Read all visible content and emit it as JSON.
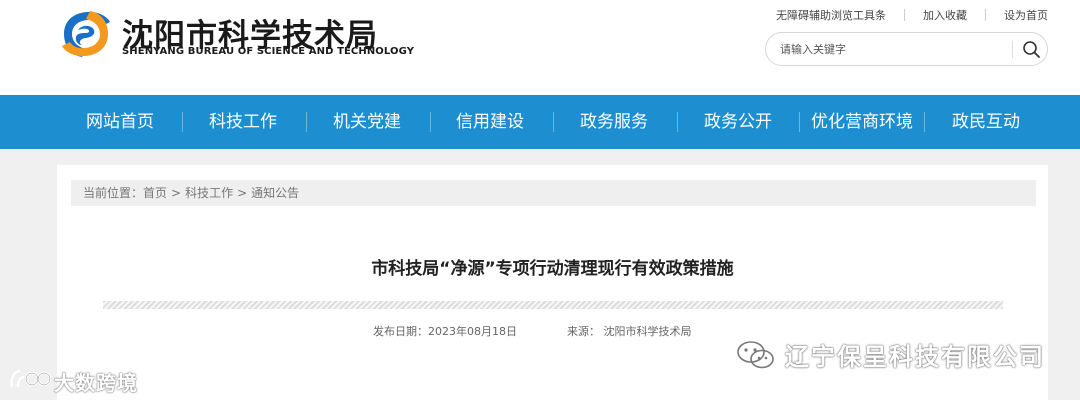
{
  "header": {
    "logo_cn": "沈阳市科学技术局",
    "logo_en": "SHENYANG BUREAU OF SCIENCE AND TECHNOLOGY",
    "toplinks": [
      "无障碍辅助浏览工具条",
      "加入收藏",
      "设为首页"
    ],
    "search_placeholder": "请输入关键字"
  },
  "nav": {
    "items": [
      "网站首页",
      "科技工作",
      "机关党建",
      "信用建设",
      "政务服务",
      "政务公开",
      "优化营商环境",
      "政民互动"
    ]
  },
  "breadcrumb": {
    "label": "当前位置：",
    "items": [
      "首页",
      "科技工作",
      "通知公告"
    ]
  },
  "article": {
    "title": "市科技局“净源”专项行动清理现行有效政策措施",
    "date": "发布日期：2023年08月18日",
    "source": "来源：  沈阳市科学技术局"
  },
  "watermarks": {
    "left": "大数跨境",
    "right": "辽宁保呈科技有限公司"
  },
  "colors": {
    "nav_bg": "#1d8fd0",
    "logo_blue": "#1a6fc9",
    "logo_orange": "#f39a1e"
  }
}
